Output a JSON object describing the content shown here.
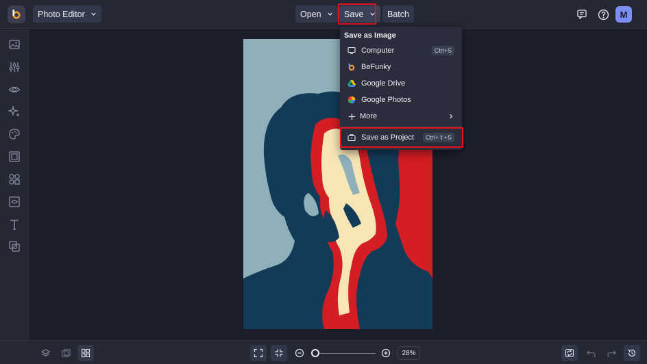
{
  "app": {
    "mode_label": "Photo Editor",
    "avatar_initial": "M",
    "accent": "#7d8ef2",
    "highlight_color": "#e0131f"
  },
  "toolbar": {
    "open_label": "Open",
    "save_label": "Save",
    "batch_label": "Batch"
  },
  "save_menu": {
    "heading": "Save as Image",
    "items": [
      {
        "label": "Computer",
        "icon": "monitor-icon",
        "shortcut": "Ctrl+S"
      },
      {
        "label": "BeFunky",
        "icon": "befunky-logo-icon",
        "shortcut": ""
      },
      {
        "label": "Google Drive",
        "icon": "google-drive-icon",
        "shortcut": ""
      },
      {
        "label": "Google Photos",
        "icon": "google-photos-icon",
        "shortcut": ""
      },
      {
        "label": "More",
        "icon": "plus-icon",
        "shortcut": ""
      }
    ],
    "project": {
      "label": "Save as Project",
      "icon": "briefcase-icon",
      "shortcut": "Ctrl+⇧+S"
    }
  },
  "sidebar": {
    "tools": [
      "image-icon",
      "adjust-sliders-icon",
      "eye-icon",
      "sparkle-icon",
      "palette-icon",
      "frame-icon",
      "shapes-icon",
      "crop-icon",
      "text-icon",
      "overlay-icon"
    ]
  },
  "bottombar": {
    "zoom_label": "28%",
    "zoom_fraction": 0.05
  },
  "canvas": {
    "colors": {
      "light": "#8fb0b8",
      "navy": "#123b57",
      "red": "#d51d25",
      "cream": "#f6e6b6"
    }
  }
}
